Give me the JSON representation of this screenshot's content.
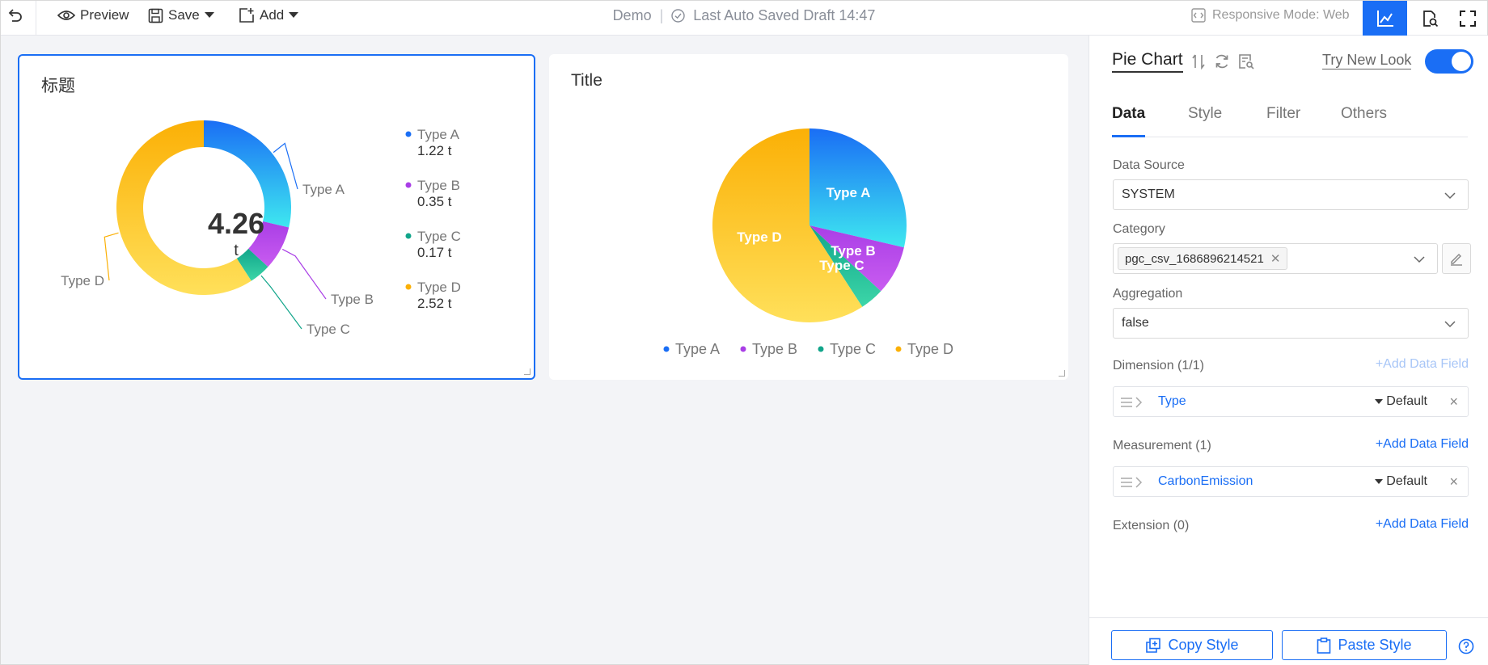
{
  "toolbar": {
    "preview_label": "Preview",
    "save_label": "Save",
    "add_label": "Add",
    "page_name": "Demo",
    "autosave_text": "Last Auto Saved Draft 14:47",
    "responsive_mode": "Responsive Mode: Web"
  },
  "cards": [
    {
      "title": "标题",
      "center_value": "4.26",
      "center_unit": "t",
      "legend": [
        {
          "name": "Type A",
          "value": "1.22",
          "unit": "t"
        },
        {
          "name": "Type B",
          "value": "0.35",
          "unit": "t"
        },
        {
          "name": "Type C",
          "value": "0.17",
          "unit": "t"
        },
        {
          "name": "Type D",
          "value": "2.52",
          "unit": "t"
        }
      ]
    },
    {
      "title": "Title",
      "legend": [
        "Type A",
        "Type B",
        "Type C",
        "Type D"
      ]
    }
  ],
  "chart_data": [
    {
      "type": "pie",
      "variant": "donut",
      "title": "标题",
      "categories": [
        "Type A",
        "Type B",
        "Type C",
        "Type D"
      ],
      "values": [
        1.22,
        0.35,
        0.17,
        2.52
      ],
      "unit": "t",
      "total": 4.26,
      "colors": [
        "#1a6ef5",
        "#a93ee6",
        "#11a58a",
        "#fbb006"
      ],
      "legend_position": "right"
    },
    {
      "type": "pie",
      "title": "Title",
      "categories": [
        "Type A",
        "Type B",
        "Type C",
        "Type D"
      ],
      "values": [
        1.22,
        0.35,
        0.17,
        2.52
      ],
      "colors": [
        "#1a6ef5",
        "#a93ee6",
        "#11a58a",
        "#fbb006"
      ],
      "legend_position": "bottom"
    }
  ],
  "panel": {
    "chart_type": "Pie Chart",
    "try_new_look": "Try New Look",
    "toggle_on": true,
    "tabs": [
      "Data",
      "Style",
      "Filter",
      "Others"
    ],
    "active_tab": "Data",
    "data_source_label": "Data Source",
    "data_source_value": "SYSTEM",
    "category_label": "Category",
    "category_tag": "pgc_csv_1686896214521",
    "aggregation_label": "Aggregation",
    "aggregation_value": "false",
    "dimension_label": "Dimension (1/1)",
    "add_field": "+Add Data Field",
    "dimension_field": "Type",
    "dimension_agg": "Default",
    "measurement_label": "Measurement (1)",
    "measurement_field": "CarbonEmission",
    "measurement_agg": "Default",
    "extension_label": "Extension (0)",
    "copy_style": "Copy Style",
    "paste_style": "Paste Style"
  },
  "colors": {
    "accent": "#1a6ef5",
    "border": "#e5e6eb"
  }
}
